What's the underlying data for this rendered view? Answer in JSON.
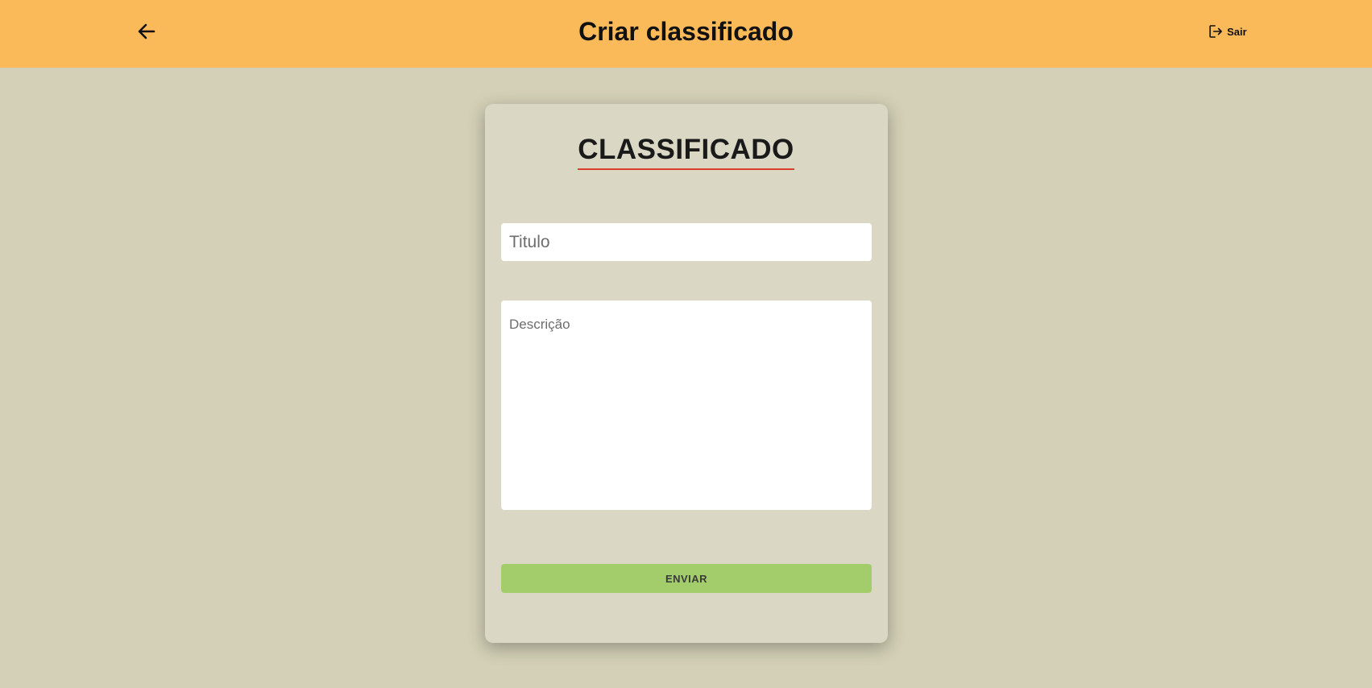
{
  "header": {
    "title": "Criar classificado",
    "back_icon": "arrow-left-icon",
    "logout_label": "Sair",
    "logout_icon": "logout-icon",
    "background_color": "#fbba5a"
  },
  "form": {
    "heading": "CLASSIFICADO",
    "heading_underline_color": "#d9412a",
    "title_field": {
      "placeholder": "Titulo",
      "value": ""
    },
    "description_field": {
      "placeholder": "Descrição",
      "value": ""
    },
    "submit_label": "ENVIAR",
    "submit_color": "#a3cd6b"
  },
  "page": {
    "background_color": "#d3d0b7",
    "card_color": "#dad7c4"
  }
}
